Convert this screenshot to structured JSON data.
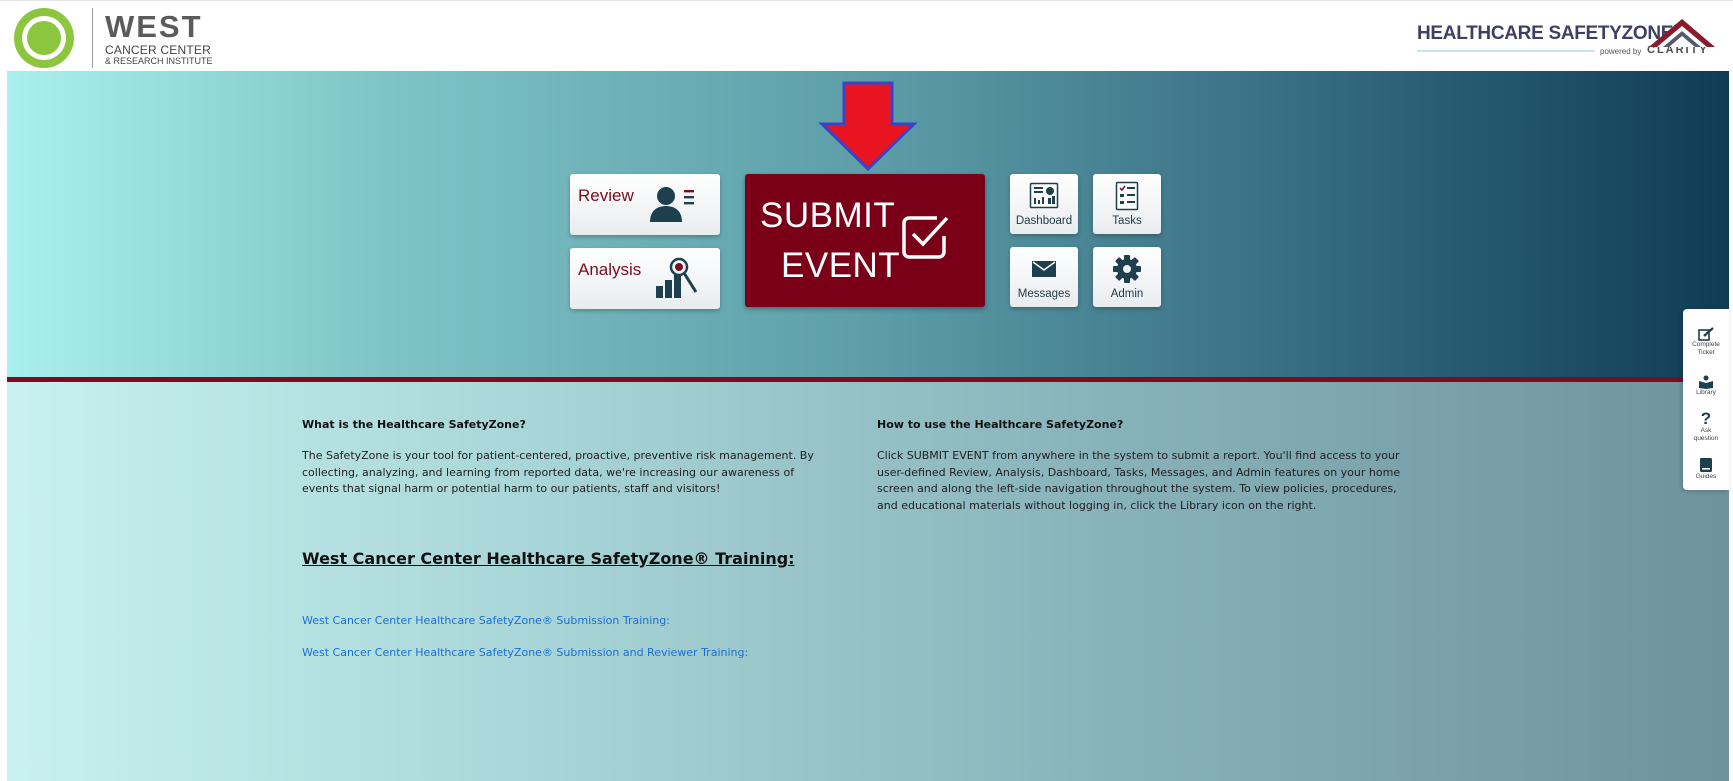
{
  "header": {
    "org_name": "WEST",
    "org_sub1": "CANCER CENTER",
    "org_sub2": "& RESEARCH INSTITUTE",
    "brand_name": "HEALTHCARE SAFETYZONE",
    "brand_reg": "®",
    "powered_by": "powered by",
    "clarity": "CLARITY"
  },
  "tiles": {
    "review": "Review",
    "analysis": "Analysis",
    "submit_line1": "SUBMIT",
    "submit_line2": "EVENT",
    "dashboard": "Dashboard",
    "tasks": "Tasks",
    "messages": "Messages",
    "admin": "Admin"
  },
  "info": {
    "what_title": "What is the Healthcare SafetyZone?",
    "what_body": "The SafetyZone is your tool for patient-centered, proactive, preventive risk management. By collecting, analyzing, and learning from reported data, we're increasing our awareness of events that signal harm or potential harm to our patients, staff and visitors!",
    "how_title": "How to use the Healthcare SafetyZone?",
    "how_body": "Click SUBMIT EVENT from anywhere in the system to submit a report. You'll find access to your user-defined Review, Analysis, Dashboard, Tasks, Messages, and Admin features on your home screen and along the left-side navigation throughout the system. To view policies, procedures, and educational materials without logging in, click the Library icon on the right."
  },
  "training": {
    "title": "West Cancer Center Healthcare SafetyZone® Training:",
    "link1": "West Cancer Center Healthcare SafetyZone® Submission Training:",
    "link2": "West Cancer Center Healthcare SafetyZone® Submission and Reviewer Training:"
  },
  "dock": {
    "complete_line1": "Complete",
    "complete_line2": "Ticket",
    "library": "Library",
    "ask_line1": "Ask",
    "ask_line2": "question",
    "guides": "Guides"
  },
  "colors": {
    "accent": "#7a0018",
    "arrow": "#e8141f",
    "link": "#1a6fd6",
    "logo_green": "#8cc63f"
  }
}
